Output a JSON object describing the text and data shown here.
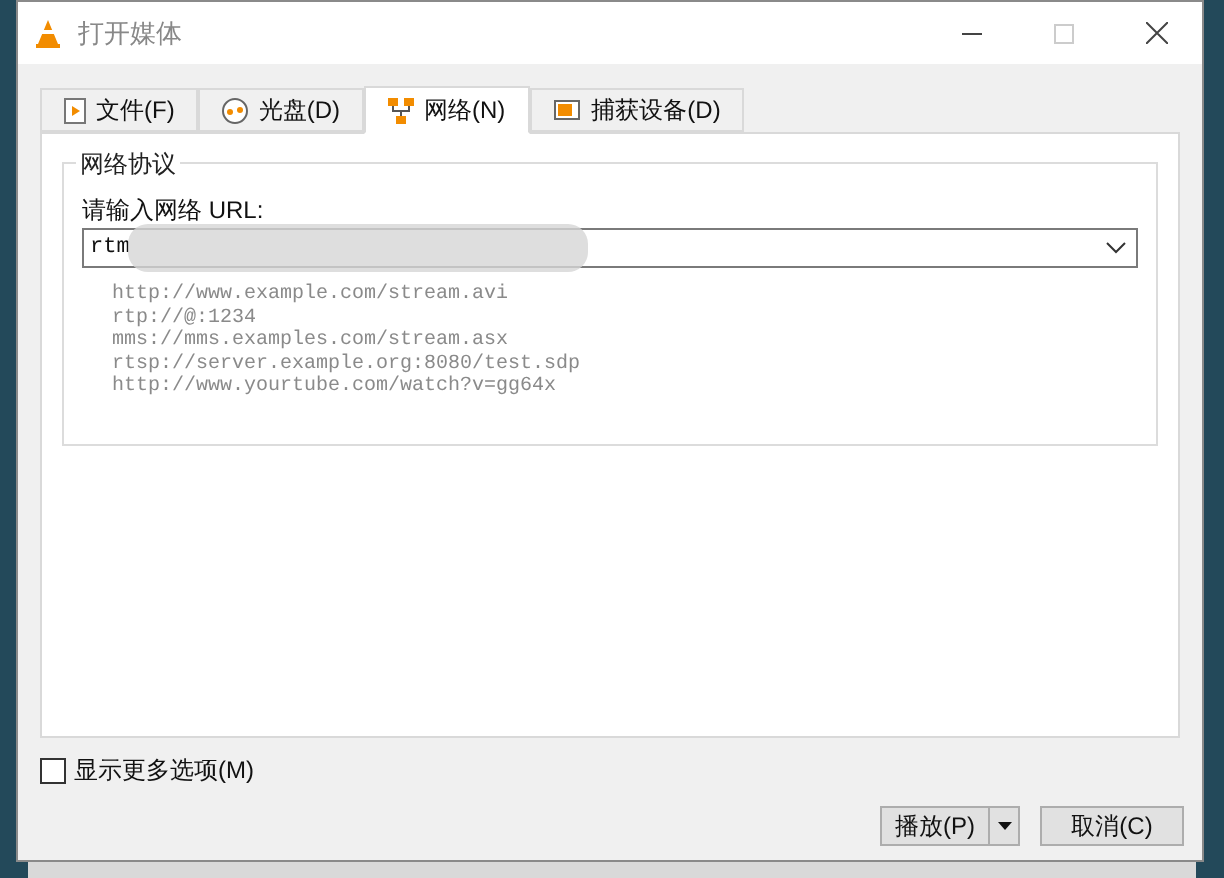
{
  "window": {
    "title": "打开媒体"
  },
  "tabs": [
    {
      "label": "文件(F)",
      "selected": false
    },
    {
      "label": "光盘(D)",
      "selected": false
    },
    {
      "label": "网络(N)",
      "selected": true
    },
    {
      "label": "捕获设备(D)",
      "selected": false
    }
  ],
  "network": {
    "group_title": "网络协议",
    "url_label": "请输入网络 URL:",
    "url_value": "rtm",
    "examples": [
      "http://www.example.com/stream.avi",
      "rtp://@:1234",
      "mms://mms.examples.com/stream.asx",
      "rtsp://server.example.org:8080/test.sdp",
      "http://www.yourtube.com/watch?v=gg64x"
    ]
  },
  "more_options": {
    "label": "显示更多选项(M)",
    "checked": false
  },
  "buttons": {
    "play": "播放(P)",
    "cancel": "取消(C)"
  }
}
